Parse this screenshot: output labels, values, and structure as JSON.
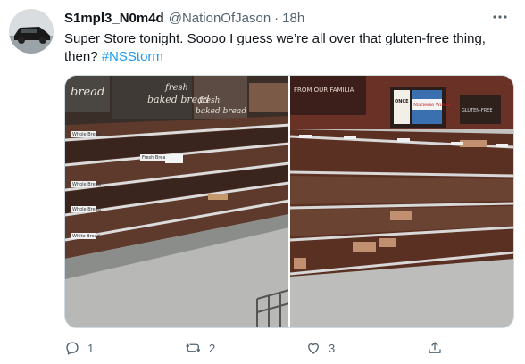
{
  "tweet": {
    "display_name": "S1mpl3_N0m4d",
    "handle": "@NationOfJason",
    "separator": "·",
    "timestamp": "18h",
    "text_line1": "Super Store tonight. Soooo I guess we’re all over that gluten-free thing,",
    "text_line2": "then?",
    "hashtag": "#NSStorm",
    "more_icon": "more-horizontal-icon",
    "avatar_icon": "car-avatar"
  },
  "media": {
    "left_photo": {
      "signs": [
        "bread",
        "fresh",
        "baked bread",
        "fresh",
        "baked bread"
      ],
      "shelf_labels": [
        "Whole Bread",
        "Fresh Bread",
        "Whole Bread",
        "Whole Bread",
        "White Bread"
      ]
    },
    "right_photo": {
      "signs": [
        "FROM OUR FAMILIA",
        "ONCE LIKE",
        "Mariesse Wilson",
        "GLUTEN-FREE"
      ]
    }
  },
  "actions": {
    "reply_count": "1",
    "retweet_count": "2",
    "like_count": "3",
    "reply_icon": "reply-icon",
    "retweet_icon": "retweet-icon",
    "like_icon": "heart-icon",
    "share_icon": "share-icon"
  },
  "colors": {
    "accent": "#1d9bf0",
    "secondary_text": "#536471",
    "primary_text": "#0f1419"
  }
}
